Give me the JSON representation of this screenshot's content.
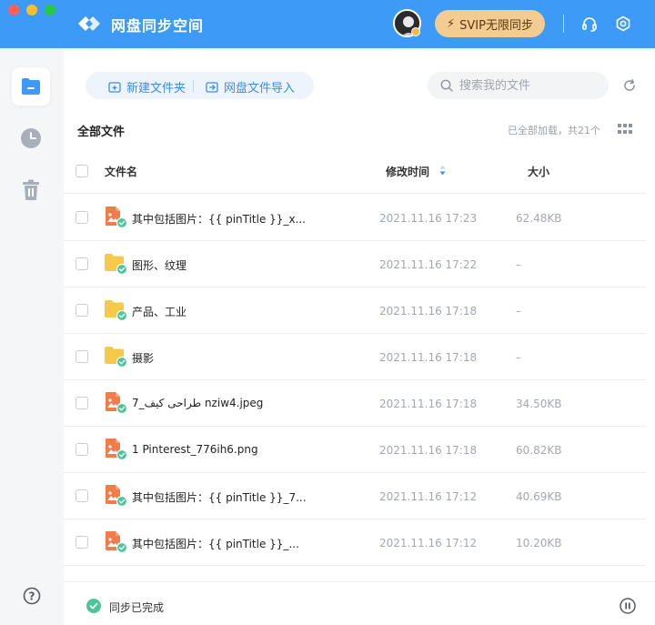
{
  "app": {
    "title": "网盘同步空间"
  },
  "header": {
    "svip_label": "SVIP无限同步"
  },
  "toolbar": {
    "new_folder_label": "新建文件夹",
    "import_label": "网盘文件导入",
    "search_placeholder": "搜索我的文件"
  },
  "listing": {
    "section_title": "全部文件",
    "loaded_info": "已全部加载，共21个"
  },
  "table": {
    "columns": {
      "name": "文件名",
      "time": "修改时间",
      "size": "大小"
    },
    "rows": [
      {
        "type": "image",
        "name": "其中包括图片：{{ pinTitle }}_x...",
        "time": "2021.11.16 17:23",
        "size": "62.48KB"
      },
      {
        "type": "folder",
        "name": "图形、纹理",
        "time": "2021.11.16 17:22",
        "size": "–"
      },
      {
        "type": "folder",
        "name": "产品、工业",
        "time": "2021.11.16 17:18",
        "size": "–"
      },
      {
        "type": "folder",
        "name": "摄影",
        "time": "2021.11.16 17:18",
        "size": "–"
      },
      {
        "type": "image",
        "name": "7_طراحی کیف nziw4.jpeg",
        "time": "2021.11.16 17:18",
        "size": "34.50KB"
      },
      {
        "type": "image",
        "name": "1 Pinterest_776ih6.png",
        "time": "2021.11.16 17:18",
        "size": "60.82KB"
      },
      {
        "type": "image",
        "name": "其中包括图片：{{ pinTitle }}_7...",
        "time": "2021.11.16 17:12",
        "size": "40.69KB"
      },
      {
        "type": "image",
        "name": "其中包括图片：{{ pinTitle }}_...",
        "time": "2021.11.16 17:12",
        "size": "10.20KB"
      }
    ]
  },
  "footer": {
    "sync_status": "同步已完成"
  },
  "colors": {
    "titlebar": "#3d9bf7",
    "accent": "#3d8de8",
    "svip_bg": "#f2cc91",
    "folder": "#f7c948",
    "image_file": "#f07c4a",
    "sync_check": "#4cc59a"
  },
  "icons": {
    "sidebar": [
      "folder-icon",
      "clock-icon",
      "trash-icon",
      "help-icon"
    ],
    "header": [
      "headset-icon",
      "settings-icon"
    ],
    "toolbar": [
      "new-folder-icon",
      "import-icon",
      "search-icon",
      "refresh-icon",
      "grid-view-icon"
    ]
  }
}
